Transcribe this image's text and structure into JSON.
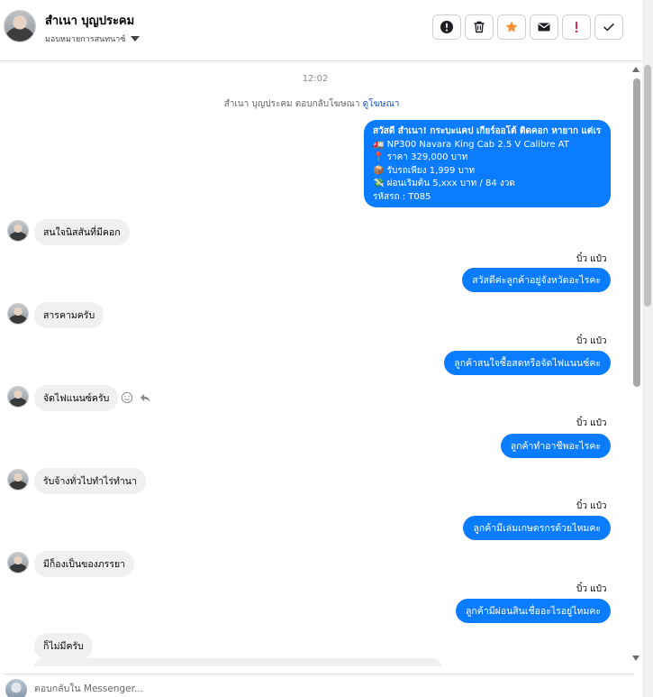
{
  "header": {
    "contact_name": "สำเนา บุญประคม",
    "assign_label": "มอบหมายการสนทนาซ์"
  },
  "actions": [
    {
      "name": "alert-circle",
      "color": "#1c1e21"
    },
    {
      "name": "trash",
      "color": "#1c1e21"
    },
    {
      "name": "star",
      "color": "#f7923a"
    },
    {
      "name": "envelope",
      "color": "#1c1e21"
    },
    {
      "name": "exclamation",
      "color": "#e41e3f"
    },
    {
      "name": "check",
      "color": "#1c1e21"
    }
  ],
  "conversation": {
    "timestamp": "12:02",
    "ad_note_prefix": "สำเนา บุญประคม ตอบกลับโฆษณา",
    "ad_note_link": "ดูโฆษณา",
    "ad_card_lines": [
      "สวัสดี สำเนา! กระบะแคป เกียร์ออโต้ ติดคอก หายาก แต่เรามี",
      "🚛 NP300 Navara King Cab 2.5 V Calibre AT",
      "📍 ราคา 329,000 บาท",
      "📦 รับรถเพียง 1,999 บาท",
      "💸 ผ่อนเริ่มต้น 5,xxx บาท / 84 งวด",
      "รหัสรถ : T085"
    ],
    "messages": [
      {
        "dir": "in",
        "text": "สนใจนิสสันที่มีคอก"
      },
      {
        "dir": "out",
        "sender": "บิ๋ว แป๋ว",
        "text": "สวัสดีค่ะลูกค้าอยู่จังหวัดอะไรคะ"
      },
      {
        "dir": "in",
        "text": "สารคามครับ"
      },
      {
        "dir": "out",
        "sender": "บิ๋ว แป๋ว",
        "text": "ลูกค้าสนใจซื้อสดหรือจัดไฟแนนซ์คะ"
      },
      {
        "dir": "in",
        "text": "จัดไฟแนนซ์ครับ"
      },
      {
        "dir": "out",
        "sender": "บิ๋ว แป๋ว",
        "text": "ลูกค้าทำอาชีพอะไรคะ"
      },
      {
        "dir": "in",
        "text": "รับจ้างทั่วไปทำไร่ทำนา"
      },
      {
        "dir": "out",
        "sender": "บิ๋ว แป๋ว",
        "text": "ลูกค้ามีเล่มเกษตรกรด้วยไหมคะ"
      },
      {
        "dir": "in",
        "text": "มีก็องเป็นของภรรยา"
      },
      {
        "dir": "out",
        "sender": "บิ๋ว แป๋ว",
        "text": "ลูกค้ามีผ่อนสินเชื่ออะไรอยู่ไหมคะ"
      },
      {
        "dir": "in",
        "text": "ก็ไม่มีครับ"
      }
    ]
  },
  "composer": {
    "placeholder": "ตอบกลับใน Messenger..."
  },
  "colors": {
    "outgoing_bubble": "#0a7cff",
    "incoming_bubble": "#f0f0f0",
    "link": "#1a56c4"
  }
}
